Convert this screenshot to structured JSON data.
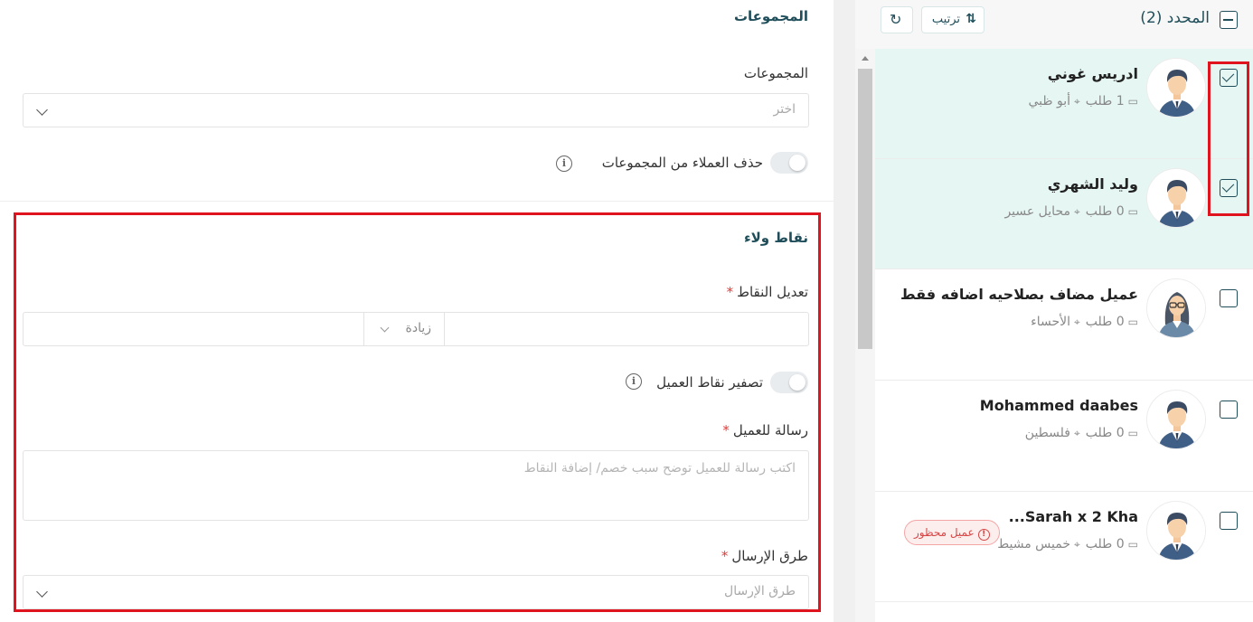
{
  "left": {
    "groups_title": "المجموعات",
    "groups_label": "المجموعات",
    "groups_placeholder": "اختر",
    "remove_from_groups_label": "حذف العملاء من المجموعات",
    "loyalty_title": "نقاط ولاء",
    "adjust_points_label": "تعديل النقاط",
    "required_mark": "*",
    "operation_value": "زيادة",
    "reset_points_label": "تصفير نقاط العميل",
    "message_label": "رسالة للعميل",
    "message_placeholder": "اكتب رسالة للعميل توضح سبب خصم/ إضافة النقاط",
    "send_methods_label": "طرق الإرسال",
    "send_methods_placeholder": "طرق الإرسال",
    "info_icon": "i"
  },
  "header": {
    "selected_label": "المحدد (2)",
    "sort_label": "ترتيب",
    "sort_icon": "⇅",
    "refresh_icon": "↻"
  },
  "customers": [
    {
      "name": "ادريس غوني",
      "orders": "1 طلب",
      "location": "أبو ظبي",
      "selected": true,
      "avatar": "male"
    },
    {
      "name": "وليد الشهري",
      "orders": "0 طلب",
      "location": "محايل عسير",
      "selected": true,
      "avatar": "male"
    },
    {
      "name": "عميل مضاف بصلاحيه اضافه فقط",
      "orders": "0 طلب",
      "location": "الأحساء",
      "selected": false,
      "avatar": "female"
    },
    {
      "name": "Mohammed daabes",
      "orders": "0 طلب",
      "location": "فلسطين",
      "selected": false,
      "avatar": "male"
    },
    {
      "name": "Sarah x 2 Kha...",
      "orders": "0 طلب",
      "location": "خميس مشيط",
      "selected": false,
      "avatar": "male",
      "badge": "عميل محظور",
      "badge_icon": "!"
    }
  ],
  "icons": {
    "box": "▭",
    "pin": "⌖"
  }
}
